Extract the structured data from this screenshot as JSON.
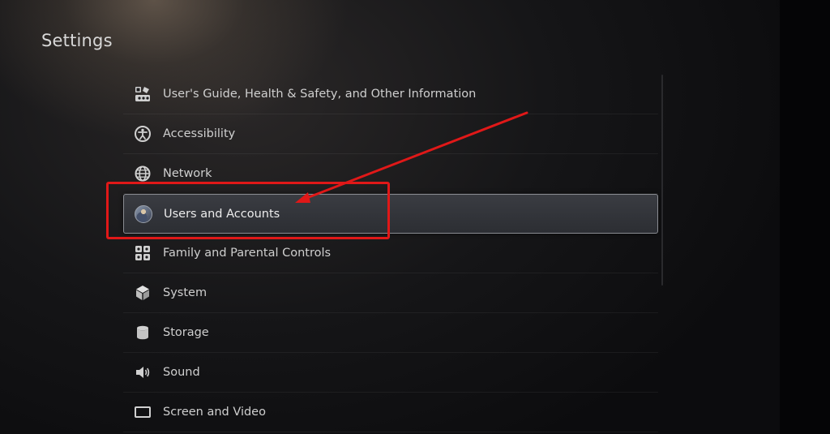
{
  "page": {
    "title": "Settings"
  },
  "menu": {
    "items": [
      {
        "label": "User's Guide, Health & Safety, and Other Information",
        "icon": "users-guide-icon"
      },
      {
        "label": "Accessibility",
        "icon": "accessibility-icon"
      },
      {
        "label": "Network",
        "icon": "globe-icon"
      },
      {
        "label": "Users and Accounts",
        "icon": "avatar-icon",
        "selected": true
      },
      {
        "label": "Family and Parental Controls",
        "icon": "family-icon"
      },
      {
        "label": "System",
        "icon": "cube-icon"
      },
      {
        "label": "Storage",
        "icon": "storage-icon"
      },
      {
        "label": "Sound",
        "icon": "speaker-icon"
      },
      {
        "label": "Screen and Video",
        "icon": "screen-icon"
      }
    ]
  },
  "annotation": {
    "color": "#e01818",
    "target": "Users and Accounts"
  }
}
